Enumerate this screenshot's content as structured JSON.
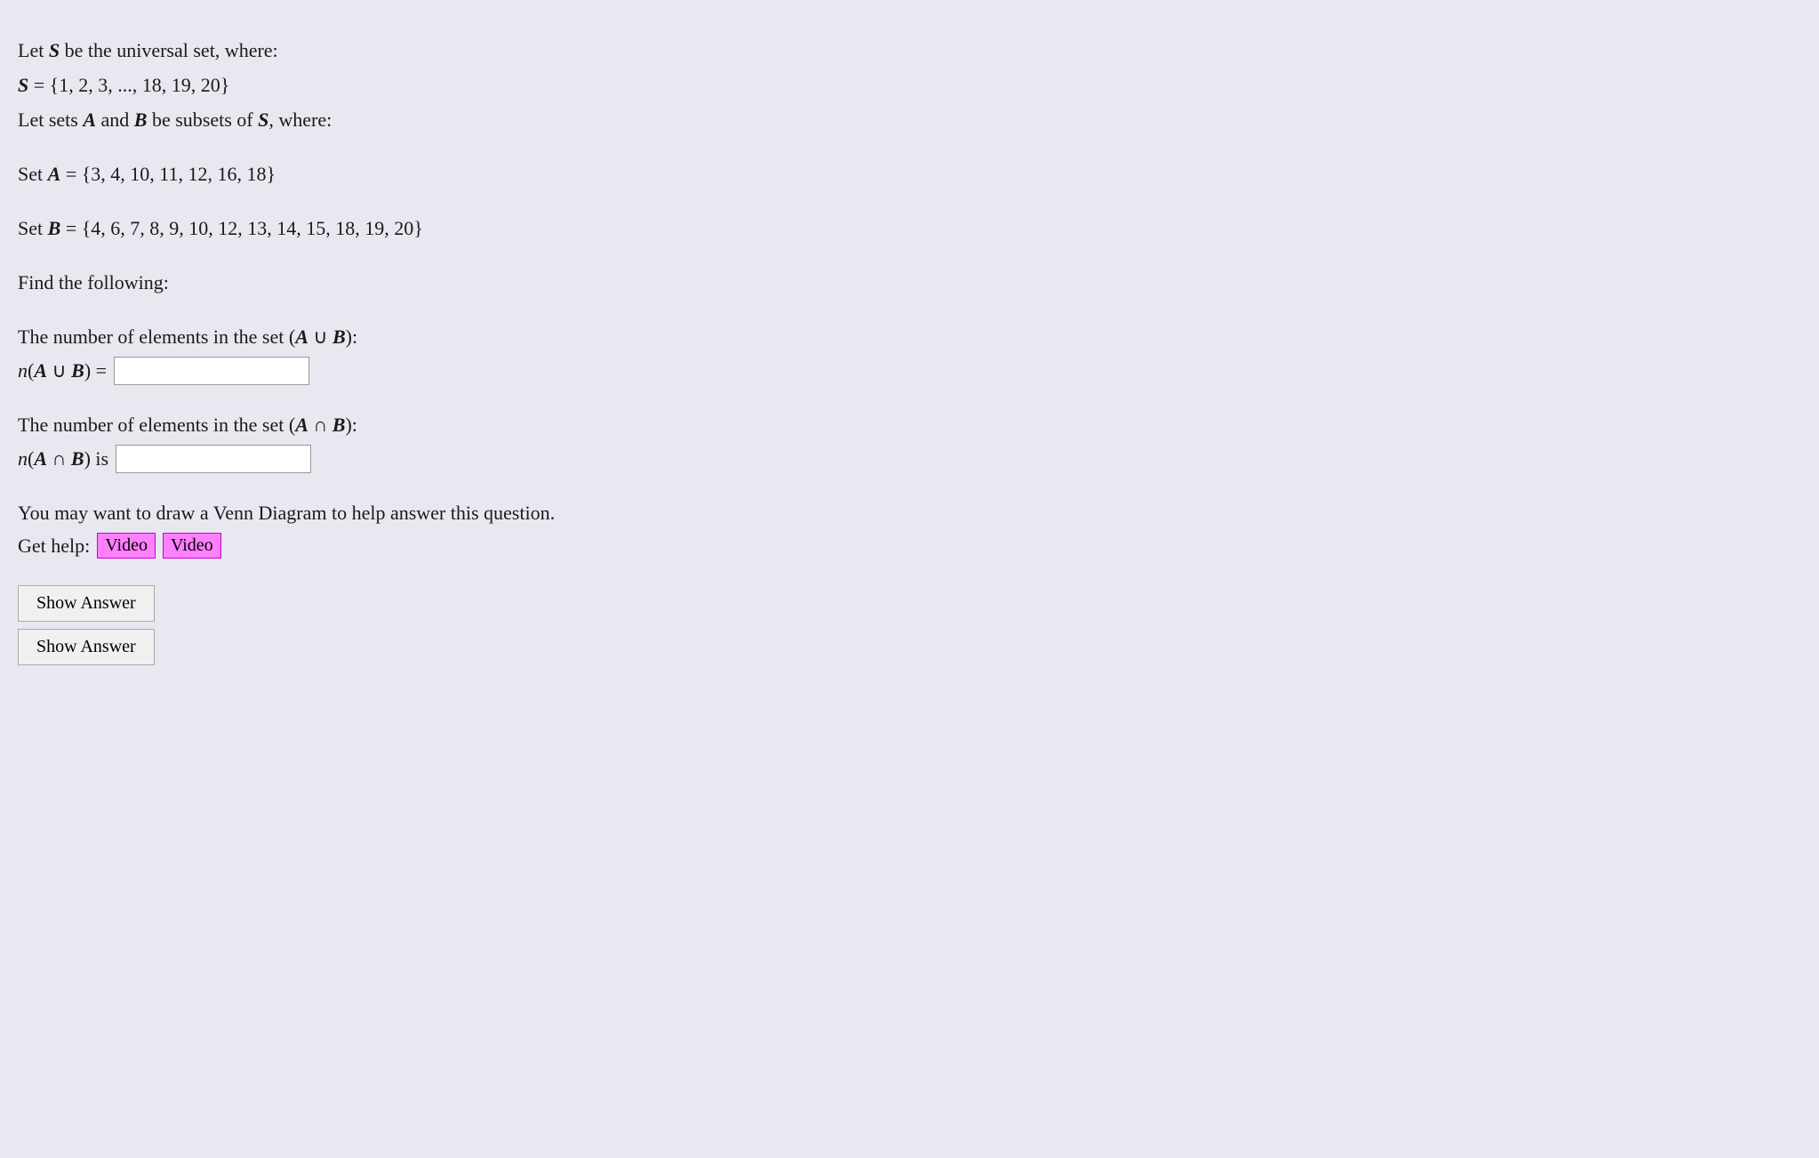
{
  "problem": {
    "intro_line1": "Let S be the universal set, where:",
    "intro_line2": "S = {1, 2, 3, ..., 18, 19, 20}",
    "intro_line3": "Let sets A and B be subsets of S, where:",
    "set_a_label": "Set A = {3, 4, 10, 11, 12, 16, 18}",
    "set_b_label": "Set B = {4, 6, 7, 8, 9, 10, 12, 13, 14, 15, 18, 19, 20}",
    "find_label": "Find the following:",
    "union_question": "The number of elements in the set (A ∪ B):",
    "union_label": "n(A ∪ B) =",
    "intersection_question": "The number of elements in the set (A ∩ B):",
    "intersection_label": "n(A ∩ B) is",
    "hint_text": "You may want to draw a Venn Diagram to help answer this question.",
    "help_label": "Get help:",
    "video1_label": "Video",
    "video2_label": "Video",
    "show_answer1_label": "Show Answer",
    "show_answer2_label": "Show Answer"
  }
}
